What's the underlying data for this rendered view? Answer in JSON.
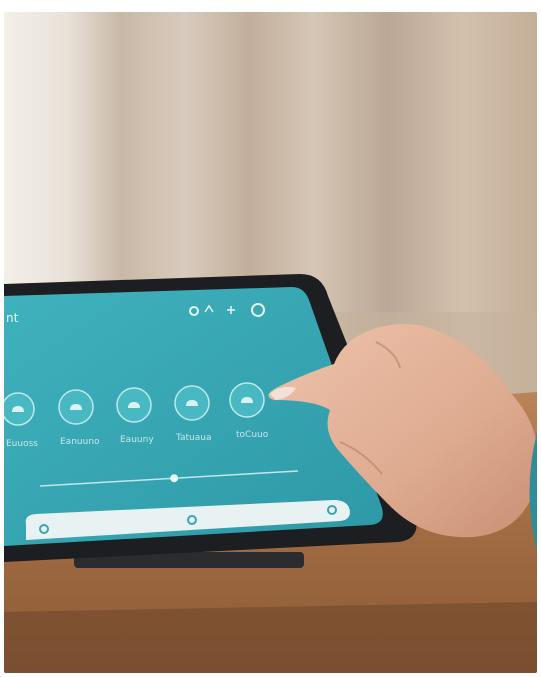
{
  "scene": {
    "description_only": false,
    "colors": {
      "curtain_light": "#d8cfc4",
      "curtain_dark": "#b9a898",
      "table": "#a9744a",
      "tablet_frame": "#1c1e21",
      "screen": "#3aa6b2",
      "skin": "#e4b39a",
      "sleeve": "#2f8c99"
    }
  },
  "tablet_screen": {
    "title": "nt",
    "status_icons": [
      "circle-icon",
      "wifi-icon",
      "settings-icon",
      "power-icon"
    ],
    "buttons": [
      {
        "label": "Euuoss",
        "icon": "cloud-icon"
      },
      {
        "label": "Eanuuno",
        "icon": "cloud-icon"
      },
      {
        "label": "Eauuny",
        "icon": "cloud-icon"
      },
      {
        "label": "Tatuaua",
        "icon": "cloud-icon"
      },
      {
        "label": "toCuuo",
        "icon": "cloud-icon"
      }
    ],
    "slider_value": 0.52,
    "bottom_bar_icons": [
      "dot-icon",
      "dot-icon",
      "dot-icon"
    ]
  }
}
